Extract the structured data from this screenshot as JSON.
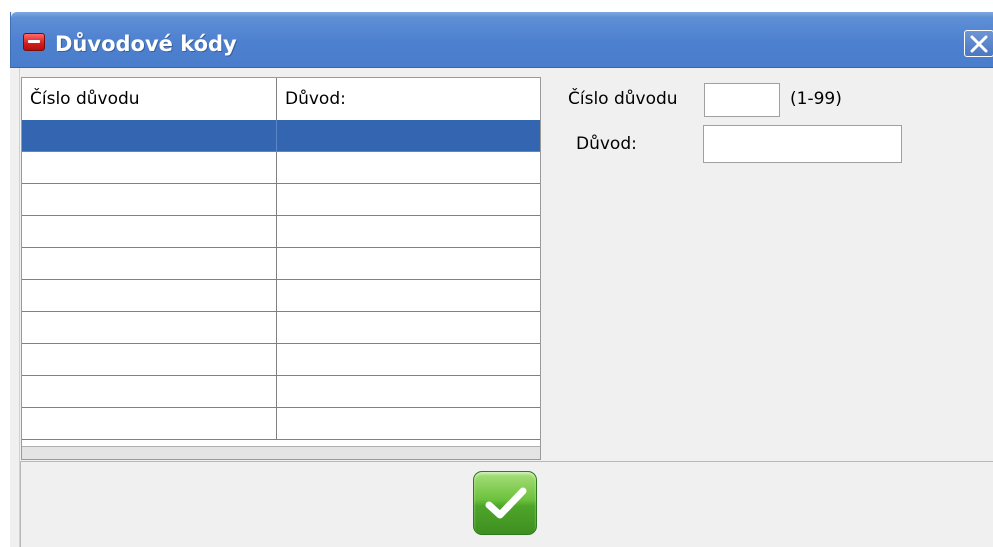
{
  "window": {
    "title": "Důvodové kódy",
    "icon": "app-icon",
    "close_icon": "close-icon"
  },
  "grid": {
    "columns": [
      "Číslo důvodu",
      "Důvod:"
    ],
    "rows": [
      [
        "",
        ""
      ],
      [
        "",
        ""
      ],
      [
        "",
        ""
      ],
      [
        "",
        ""
      ],
      [
        "",
        ""
      ],
      [
        "",
        ""
      ],
      [
        "",
        ""
      ],
      [
        "",
        ""
      ],
      [
        "",
        ""
      ],
      [
        "",
        ""
      ]
    ],
    "selected_row": 0,
    "selection_color": "#3465b0"
  },
  "form": {
    "reason_number_label": "Číslo důvodu",
    "reason_number_value": "",
    "reason_number_range": "(1-99)",
    "reason_label": "Důvod:",
    "reason_value": ""
  },
  "footer": {
    "ok_icon": "checkmark-icon",
    "ok_color": "#5ab52e"
  }
}
